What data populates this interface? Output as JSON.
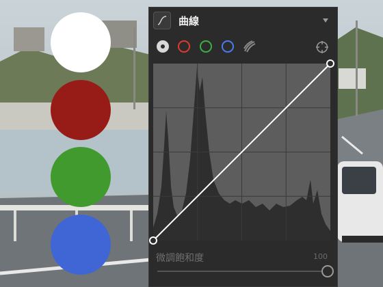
{
  "colors": {
    "white": "#ffffff",
    "red": "#971c17",
    "green": "#419a2e",
    "blue": "#3f66d4",
    "panel_bg": "#2b2b2b"
  },
  "swatches": [
    {
      "name": "white",
      "color": "#ffffff"
    },
    {
      "name": "red",
      "color": "#971c17"
    },
    {
      "name": "green",
      "color": "#419a2e"
    },
    {
      "name": "blue",
      "color": "#3f66d4"
    }
  ],
  "panel": {
    "title": "曲線",
    "tool_icon": "curve-icon",
    "collapse_icon": "triangle-down-icon",
    "channels": [
      {
        "name": "rgb",
        "icon": "rgb-dot-icon",
        "selected": true
      },
      {
        "name": "red",
        "icon": "red-ring-icon"
      },
      {
        "name": "green",
        "icon": "green-ring-icon"
      },
      {
        "name": "blue",
        "icon": "blue-ring-icon"
      },
      {
        "name": "saturation",
        "icon": "saturation-swirl-icon"
      }
    ],
    "picker_icon": "target-picker-icon",
    "saturation": {
      "label": "微調飽和度",
      "value": "100"
    }
  }
}
